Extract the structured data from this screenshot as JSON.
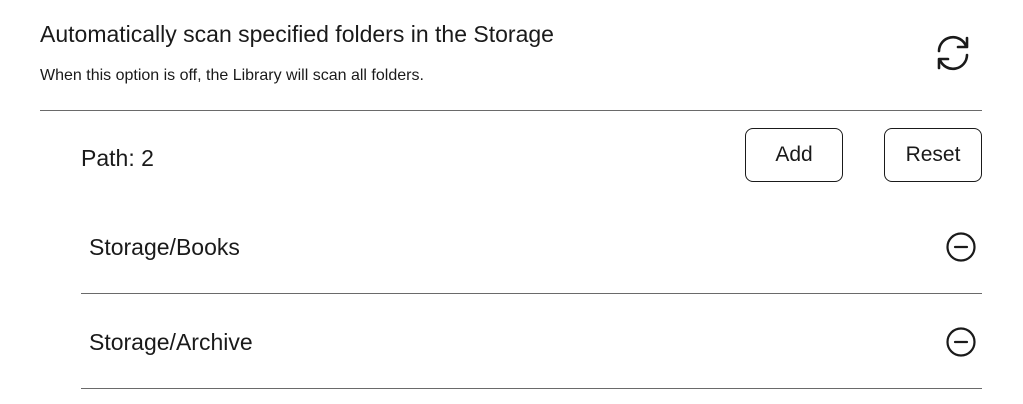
{
  "header": {
    "title": "Automatically scan specified folders in the Storage",
    "subtitle": "When this option is off, the Library will scan all folders.",
    "sync_icon": "sync-icon"
  },
  "paths": {
    "label": "Path: 2",
    "add_label": "Add",
    "reset_label": "Reset",
    "folders": [
      {
        "name": "Storage/Books",
        "icon": "remove-circle-icon"
      },
      {
        "name": "Storage/Archive",
        "icon": "remove-circle-icon"
      }
    ]
  },
  "colors": {
    "text": "#1a1a1a",
    "divider": "#6a6a6a",
    "background": "#ffffff"
  }
}
